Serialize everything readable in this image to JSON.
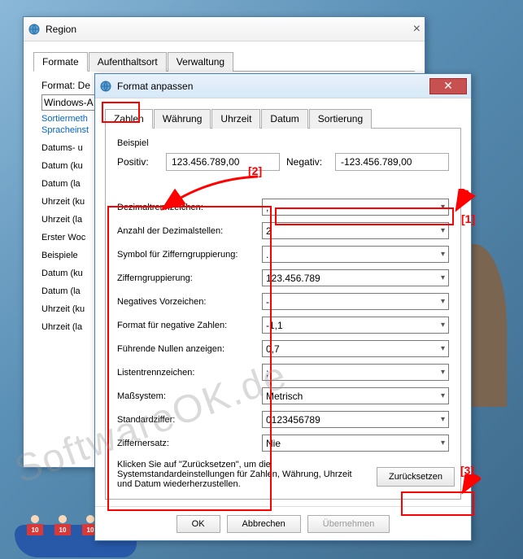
{
  "region_window": {
    "title": "Region",
    "tabs": [
      "Formate",
      "Aufenthaltsort",
      "Verwaltung"
    ],
    "active_tab": 0,
    "format_label": "Format: De",
    "format_value": "Windows-A",
    "link_sort": "Sortiermeth",
    "link_lang": "Spracheinst",
    "group1": [
      "Datums- u",
      "Datum (ku",
      "Datum (la",
      "Uhrzeit (ku",
      "Uhrzeit (la",
      "Erster Woc"
    ],
    "group2": [
      "Beispiele",
      "Datum (ku",
      "Datum (la",
      "Uhrzeit (ku",
      "Uhrzeit (la"
    ]
  },
  "format_window": {
    "title": "Format anpassen",
    "tabs": [
      "Zahlen",
      "Währung",
      "Uhrzeit",
      "Datum",
      "Sortierung"
    ],
    "active_tab": 0,
    "example_label": "Beispiel",
    "positive_label": "Positiv:",
    "positive_value": "123.456.789,00",
    "negative_label": "Negativ:",
    "negative_value": "-123.456.789,00",
    "rows": [
      {
        "label": "Dezimaltrennzeichen:",
        "value": ","
      },
      {
        "label": "Anzahl der Dezimalstellen:",
        "value": "2"
      },
      {
        "label": "Symbol für Zifferngruppierung:",
        "value": "."
      },
      {
        "label": "Zifferngruppierung:",
        "value": "123.456.789"
      },
      {
        "label": "Negatives Vorzeichen:",
        "value": "-"
      },
      {
        "label": "Format für negative Zahlen:",
        "value": "-1,1"
      },
      {
        "label": "Führende Nullen anzeigen:",
        "value": "0,7"
      },
      {
        "label": "Listentrennzeichen:",
        "value": ";"
      },
      {
        "label": "Maßsystem:",
        "value": "Metrisch"
      },
      {
        "label": "Standardziffer:",
        "value": "0123456789"
      },
      {
        "label": "Ziffernersatz:",
        "value": "Nie"
      }
    ],
    "help_text": "Klicken Sie auf \"Zurücksetzen\", um die Systemstandardeinstellungen für Zahlen, Währung, Uhrzeit und Datum wiederherzustellen.",
    "reset_button": "Zurücksetzen",
    "ok_button": "OK",
    "cancel_button": "Abbrechen",
    "apply_button": "Übernehmen"
  },
  "annotations": {
    "a1": "[1]",
    "a2": "[2]",
    "a3": "[3]"
  },
  "watermark": "SoftwareOK.de",
  "person_badge": "10"
}
